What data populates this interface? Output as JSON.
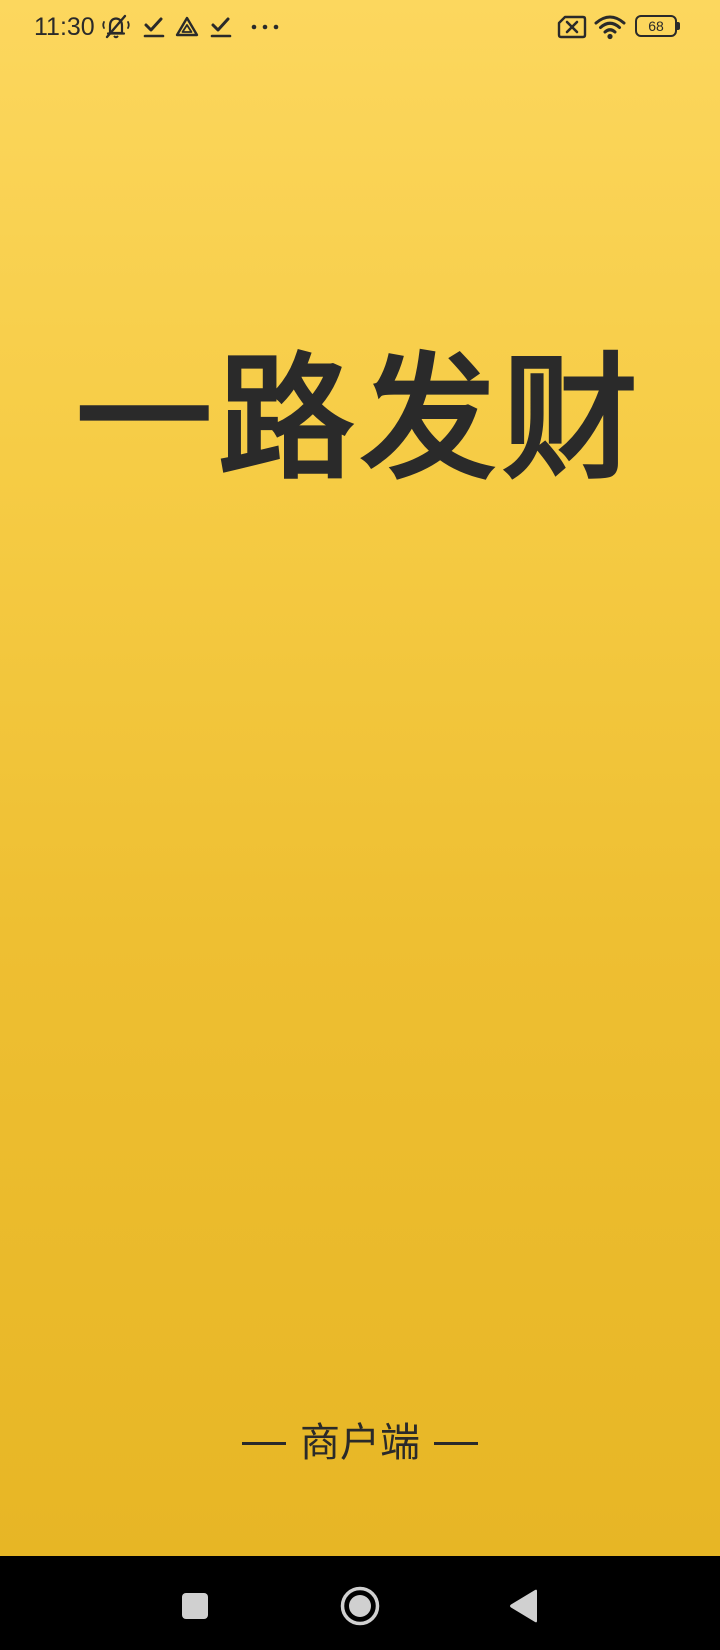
{
  "status_bar": {
    "time": "11:30",
    "battery_level": "68",
    "left_icons": [
      "silent-bell-icon",
      "checkmark-icon",
      "triangle-app-icon",
      "checkmark-icon",
      "more-dots-icon"
    ],
    "right_icons": [
      "no-sim-icon",
      "wifi-icon",
      "battery-icon"
    ]
  },
  "splash": {
    "title": "一路发财",
    "subtitle": "商户端"
  },
  "navigation": {
    "buttons": [
      "recents-square-icon",
      "home-circle-icon",
      "back-triangle-icon"
    ]
  },
  "colors": {
    "background_top": "#fcd75e",
    "background_bottom": "#e7b625",
    "text": "#2a2a2a",
    "nav_bar": "#000000"
  }
}
